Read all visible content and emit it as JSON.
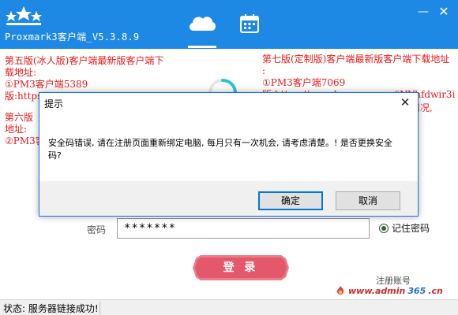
{
  "app": {
    "title": "Proxmark3客户端_V5.3.8.9",
    "accent_color": "#1e88e5",
    "notice_color": "#e41b1b"
  },
  "titlebar": {
    "icons": [
      "stars-logo-icon",
      "cloud-icon",
      "calendar-icon"
    ],
    "minimize_label": "—",
    "close_label": "✕"
  },
  "notices": {
    "left": [
      "第五版(冰人版)客户端最新版客户端下",
      "载地址:",
      "①PM3客户端5389",
      "版:https://www.lanzous.com/iDD47ob..."
    ],
    "left_lower": [
      "第六版",
      "地址:",
      "②PM3客"
    ],
    "right": [
      "第七版(定制版)客户端最新版客户端下载地址",
      ":",
      "①PM3客户端7069",
      "版:https://wwa.lanzous.com/iNVhfdwir3i"
    ],
    "right_fragment": "响情况,"
  },
  "login": {
    "password_label": "密码",
    "password_value": "*******",
    "remember_label": "记住密码",
    "remember_checked": true,
    "login_button": "登 录",
    "register_link": "注册账号"
  },
  "watermark": {
    "prefix": "www.admin",
    "number": "365",
    "suffix": ".cn"
  },
  "status": {
    "text": "状态: 服务器链接成功!"
  },
  "dialog": {
    "title": "提示",
    "close_label": "✕",
    "message": "安全码错误, 请在注册页面重新绑定电脑, 每月只有一次机会, 请考虑清楚。! 是否更换安全码?",
    "ok_label": "确定",
    "cancel_label": "取消"
  }
}
